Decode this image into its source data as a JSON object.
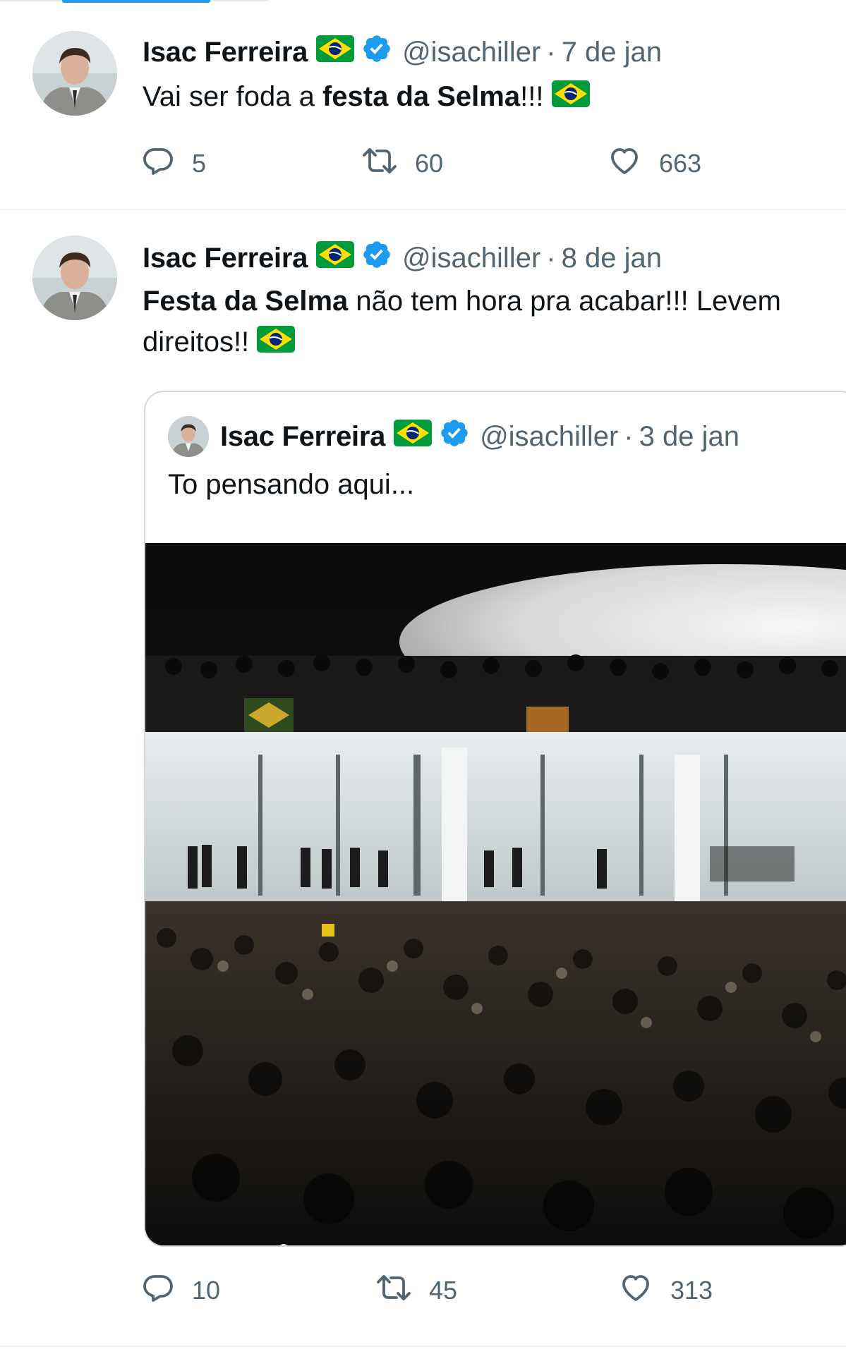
{
  "tweets": [
    {
      "author": "Isac Ferreira",
      "handle": "@isachiller",
      "separator": "·",
      "date": "7 de jan",
      "text_parts": [
        {
          "t": "Vai ser foda a ",
          "bold": false
        },
        {
          "t": "festa da Selma",
          "bold": true
        },
        {
          "t": "!!! ",
          "bold": false
        }
      ],
      "counts": {
        "replies": "5",
        "retweets": "60",
        "likes": "663"
      }
    },
    {
      "author": "Isac Ferreira",
      "handle": "@isachiller",
      "separator": "·",
      "date": "8 de jan",
      "line1_bold": "Festa da Selma",
      "line1_rest": " não tem hora pra acabar!!! Levem",
      "line2": "direitos!! ",
      "counts": {
        "replies": "10",
        "retweets": "45",
        "likes": "313"
      },
      "quote": {
        "author": "Isac Ferreira",
        "handle": "@isachiller",
        "separator": "·",
        "date": "3 de jan",
        "text": "To pensando aqui..."
      }
    }
  ],
  "colors": {
    "accent": "#1d9bf0",
    "muted": "#536471",
    "text": "#0f1419",
    "flag_green": "#009b3a",
    "flag_yellow": "#fedf00",
    "flag_blue": "#002776"
  },
  "icons": [
    "reply-icon",
    "retweet-icon",
    "like-icon",
    "verified-badge-icon",
    "brazil-flag-icon"
  ]
}
